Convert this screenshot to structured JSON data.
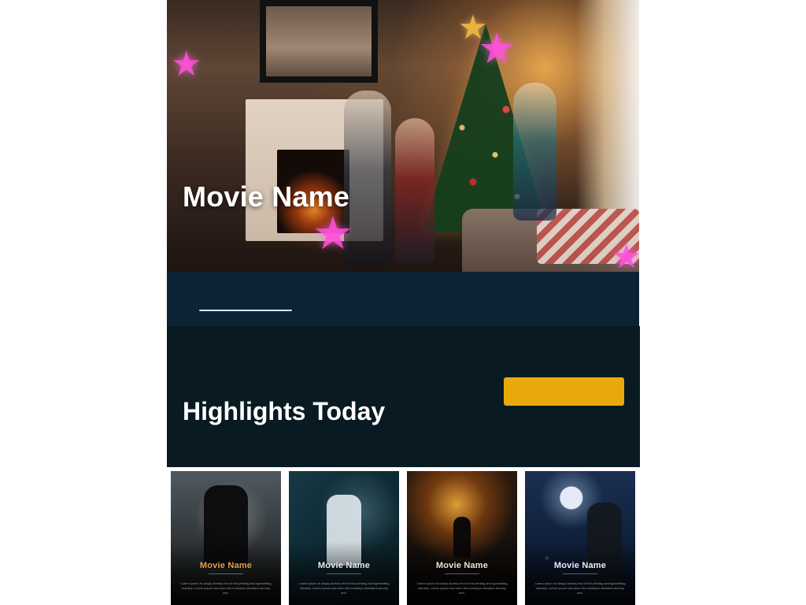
{
  "hero": {
    "title": "Movie Name",
    "icons": [
      "star-icon",
      "star-icon",
      "star-icon",
      "star-icon",
      "tree-topper-star-icon"
    ]
  },
  "highlights": {
    "heading": "Highlights Today",
    "button_label": ""
  },
  "posters": [
    {
      "title": "Movie Name",
      "description": "Lorem ipsum is simply dummy text of the printing and typesetting industry. Lorem ipsum has been the industry's standard dummy text.",
      "title_color": "#e9a34a"
    },
    {
      "title": "Movie Name",
      "description": "Lorem ipsum is simply dummy text of the printing and typesetting industry. Lorem ipsum has been the industry's standard dummy text.",
      "title_color": "#e8eef2"
    },
    {
      "title": "Movie Name",
      "description": "Lorem ipsum is simply dummy text of the printing and typesetting industry. Lorem ipsum has been the industry's standard dummy text.",
      "title_color": "#f1e2cf"
    },
    {
      "title": "Movie Name",
      "description": "Lorem ipsum is simply dummy text of the printing and typesetting industry. Lorem ipsum has been the industry's standard dummy text.",
      "title_color": "#e9f0ff"
    }
  ],
  "colors": {
    "strip_bg": "#0c2336",
    "highlights_bg": "#091a23",
    "accent": "#e9a90b",
    "text": "#ffffff"
  }
}
